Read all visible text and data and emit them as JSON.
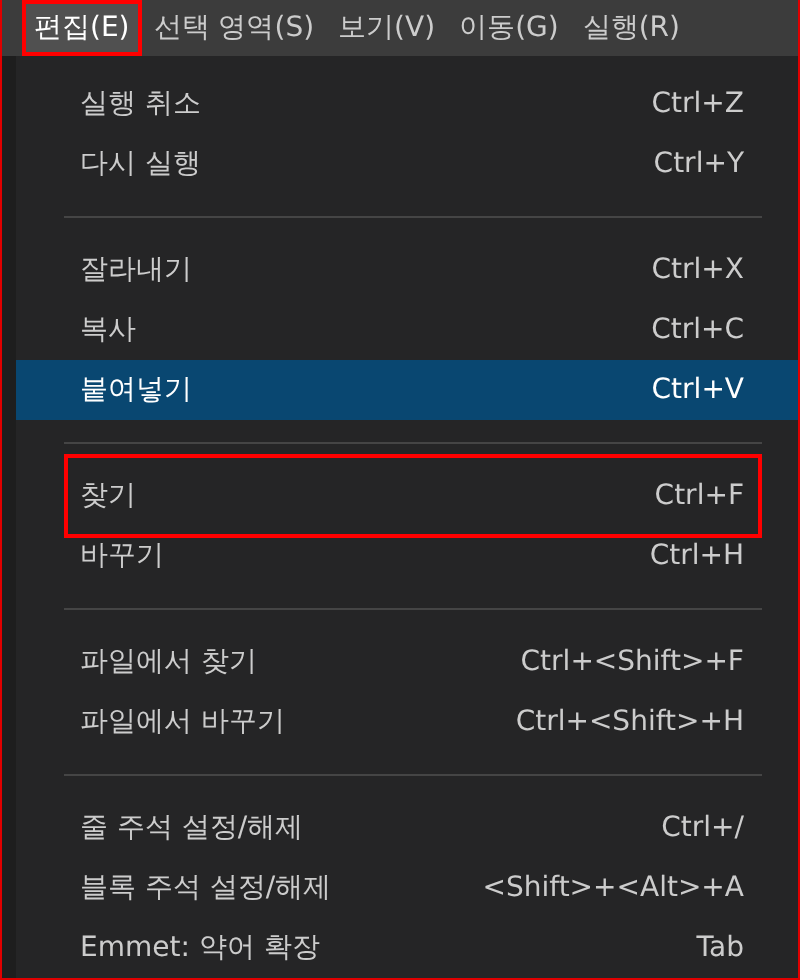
{
  "menu_bar": {
    "items": [
      {
        "label": "편집(E)",
        "selected": true,
        "annotated": true
      },
      {
        "label": "선택 영역(S)",
        "selected": false,
        "annotated": false
      },
      {
        "label": "보기(V)",
        "selected": false,
        "annotated": false
      },
      {
        "label": "이동(G)",
        "selected": false,
        "annotated": false
      },
      {
        "label": "실행(R)",
        "selected": false,
        "annotated": false
      }
    ]
  },
  "menu": {
    "groups": [
      {
        "items": [
          {
            "label": "실행 취소",
            "shortcut": "Ctrl+Z",
            "selected": false,
            "annotated": false
          },
          {
            "label": "다시 실행",
            "shortcut": "Ctrl+Y",
            "selected": false,
            "annotated": false
          }
        ]
      },
      {
        "items": [
          {
            "label": "잘라내기",
            "shortcut": "Ctrl+X",
            "selected": false,
            "annotated": false
          },
          {
            "label": "복사",
            "shortcut": "Ctrl+C",
            "selected": false,
            "annotated": false
          },
          {
            "label": "붙여넣기",
            "shortcut": "Ctrl+V",
            "selected": true,
            "annotated": false
          }
        ]
      },
      {
        "items": [
          {
            "label": "찾기",
            "shortcut": "Ctrl+F",
            "selected": false,
            "annotated": true
          },
          {
            "label": "바꾸기",
            "shortcut": "Ctrl+H",
            "selected": false,
            "annotated": false
          }
        ]
      },
      {
        "items": [
          {
            "label": "파일에서 찾기",
            "shortcut": "Ctrl+<Shift>+F",
            "selected": false,
            "annotated": false
          },
          {
            "label": "파일에서 바꾸기",
            "shortcut": "Ctrl+<Shift>+H",
            "selected": false,
            "annotated": false
          }
        ]
      },
      {
        "items": [
          {
            "label": "줄 주석 설정/해제",
            "shortcut": "Ctrl+/",
            "selected": false,
            "annotated": false
          },
          {
            "label": "블록 주석 설정/해제",
            "shortcut": "<Shift>+<Alt>+A",
            "selected": false,
            "annotated": false
          },
          {
            "label": "Emmet: 약어 확장",
            "shortcut": "Tab",
            "selected": false,
            "annotated": false
          }
        ]
      }
    ]
  }
}
